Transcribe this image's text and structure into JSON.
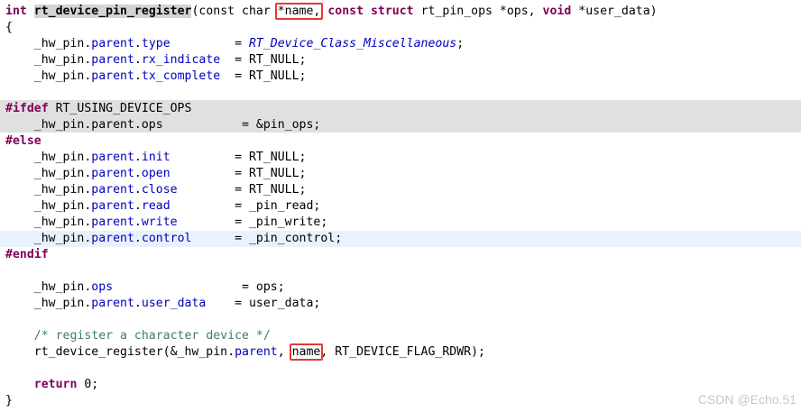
{
  "code": {
    "lines": [
      [
        {
          "t": "int",
          "c": "kw"
        },
        {
          "t": " "
        },
        {
          "t": "rt_device_pin_register",
          "c": "fn hl"
        },
        {
          "t": "(const char "
        },
        {
          "t": "*name,",
          "c": "hi"
        },
        {
          "t": " "
        },
        {
          "t": "const",
          "c": "kw"
        },
        {
          "t": " "
        },
        {
          "t": "struct",
          "c": "kw"
        },
        {
          "t": " rt_pin_ops *ops, "
        },
        {
          "t": "void",
          "c": "kw"
        },
        {
          "t": " *user_data)"
        }
      ],
      [
        {
          "t": "{"
        }
      ],
      [
        {
          "t": "    _hw_pin."
        },
        {
          "t": "parent",
          "c": "fld"
        },
        {
          "t": "."
        },
        {
          "t": "type",
          "c": "fld"
        },
        {
          "t": "         = "
        },
        {
          "t": "RT_Device_Class_Miscellaneous",
          "c": "enm"
        },
        {
          "t": ";"
        }
      ],
      [
        {
          "t": "    _hw_pin."
        },
        {
          "t": "parent",
          "c": "fld"
        },
        {
          "t": "."
        },
        {
          "t": "rx_indicate",
          "c": "fld"
        },
        {
          "t": "  = RT_NULL;"
        }
      ],
      [
        {
          "t": "    _hw_pin."
        },
        {
          "t": "parent",
          "c": "fld"
        },
        {
          "t": "."
        },
        {
          "t": "tx_complete",
          "c": "fld"
        },
        {
          "t": "  = RT_NULL;"
        }
      ],
      [],
      [
        {
          "t": "#ifdef",
          "c": "pp"
        },
        {
          "t": " RT_USING_DEVICE_OPS"
        }
      ],
      [
        {
          "t": "    _hw_pin.parent.ops           = &pin_ops;"
        }
      ],
      [
        {
          "t": "#else",
          "c": "pp"
        }
      ],
      [
        {
          "t": "    _hw_pin."
        },
        {
          "t": "parent",
          "c": "fld"
        },
        {
          "t": "."
        },
        {
          "t": "init",
          "c": "fld"
        },
        {
          "t": "         = RT_NULL;"
        }
      ],
      [
        {
          "t": "    _hw_pin."
        },
        {
          "t": "parent",
          "c": "fld"
        },
        {
          "t": "."
        },
        {
          "t": "open",
          "c": "fld"
        },
        {
          "t": "         = RT_NULL;"
        }
      ],
      [
        {
          "t": "    _hw_pin."
        },
        {
          "t": "parent",
          "c": "fld"
        },
        {
          "t": "."
        },
        {
          "t": "close",
          "c": "fld"
        },
        {
          "t": "        = RT_NULL;"
        }
      ],
      [
        {
          "t": "    _hw_pin."
        },
        {
          "t": "parent",
          "c": "fld"
        },
        {
          "t": "."
        },
        {
          "t": "read",
          "c": "fld"
        },
        {
          "t": "         = _pin_read;"
        }
      ],
      [
        {
          "t": "    _hw_pin."
        },
        {
          "t": "parent",
          "c": "fld"
        },
        {
          "t": "."
        },
        {
          "t": "write",
          "c": "fld"
        },
        {
          "t": "        = _pin_write;"
        }
      ],
      [
        {
          "t": "    _hw_pin."
        },
        {
          "t": "parent",
          "c": "fld"
        },
        {
          "t": "."
        },
        {
          "t": "control",
          "c": "fld"
        },
        {
          "t": "      = _pin_control;"
        }
      ],
      [
        {
          "t": "#endif",
          "c": "pp"
        }
      ],
      [],
      [
        {
          "t": "    _hw_pin."
        },
        {
          "t": "ops",
          "c": "fld"
        },
        {
          "t": "                  = ops;"
        }
      ],
      [
        {
          "t": "    _hw_pin."
        },
        {
          "t": "parent",
          "c": "fld"
        },
        {
          "t": "."
        },
        {
          "t": "user_data",
          "c": "fld"
        },
        {
          "t": "    = user_data;"
        }
      ],
      [],
      [
        {
          "t": "    "
        },
        {
          "t": "/* register a character device */",
          "c": "cm"
        }
      ],
      [
        {
          "t": "    rt_device_register(&_hw_pin."
        },
        {
          "t": "parent",
          "c": "fld"
        },
        {
          "t": ", "
        },
        {
          "t": "name",
          "c": "hi"
        },
        {
          "t": ", RT_DEVICE_FLAG_RDWR);"
        }
      ],
      [],
      [
        {
          "t": "    "
        },
        {
          "t": "return",
          "c": "kw"
        },
        {
          "t": " 0;"
        }
      ],
      [
        {
          "t": "}"
        }
      ]
    ]
  },
  "watermark": "CSDN @Echo.51"
}
